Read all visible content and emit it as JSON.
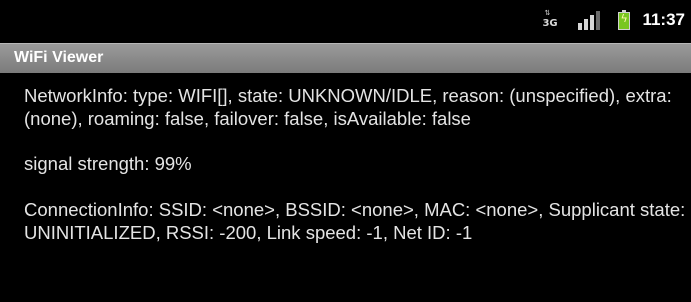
{
  "status_bar": {
    "network_label": "3G",
    "network_arrows": "⇅",
    "signal_icon": "signal-bars-icon",
    "battery_icon": "battery-charging-icon",
    "time": "11:37"
  },
  "app": {
    "title": "WiFi Viewer"
  },
  "content": {
    "network_info": "NetworkInfo: type: WIFI[], state: UNKNOWN/IDLE, reason: (unspecified), extra: (none), roaming: false, failover: false, isAvailable: false",
    "signal_strength": "signal strength: 99%",
    "connection_info": "ConnectionInfo: SSID: <none>, BSSID: <none>, MAC: <none>, Supplicant state: UNINITIALIZED, RSSI: -200, Link speed: -1, Net ID: -1"
  },
  "colors": {
    "background": "#000000",
    "title_bar": "#8a8a8a",
    "battery_fill": "#79c61f"
  }
}
